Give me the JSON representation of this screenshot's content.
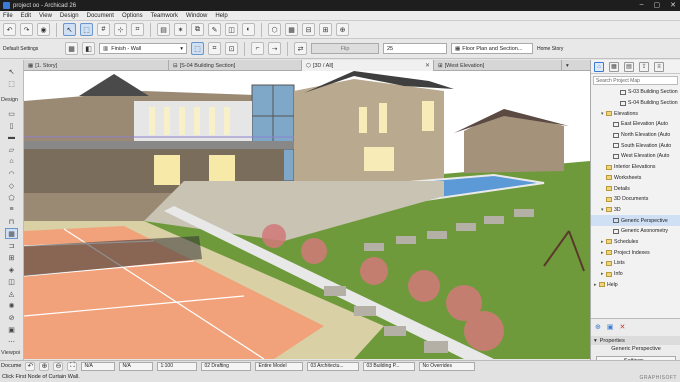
{
  "window": {
    "title": "project oo - Archicad 26"
  },
  "menu": [
    "File",
    "Edit",
    "View",
    "Design",
    "Document",
    "Options",
    "Teamwork",
    "Window",
    "Help"
  ],
  "toolbar2": {
    "default_settings": "Default Settings",
    "composite": "Finish - Wall",
    "flip": "Flip",
    "value": "25",
    "view_combo": "Floor Plan and Section...",
    "home_story": "Home Story"
  },
  "tabs": [
    {
      "label": "[1. Story]"
    },
    {
      "label": "[S-04 Building Section]"
    },
    {
      "label": "[3D / All]"
    },
    {
      "label": "[West Elevation]"
    }
  ],
  "toolbox": {
    "label_select": "Select",
    "label_design": "Design",
    "label_viewpoint": "Viewpoi",
    "label_document": "Docume"
  },
  "navigator": {
    "search_placeholder": "Search Project Map",
    "items": [
      {
        "label": "S-03 Building Section",
        "indent": 3,
        "type": "section"
      },
      {
        "label": "S-04 Building Section",
        "indent": 3,
        "type": "section"
      },
      {
        "label": "Elevations",
        "indent": 1,
        "type": "folder",
        "twist": "▾"
      },
      {
        "label": "East Elevation (Auto",
        "indent": 2,
        "type": "elev"
      },
      {
        "label": "North Elevation (Auto",
        "indent": 2,
        "type": "elev"
      },
      {
        "label": "South Elevation (Auto",
        "indent": 2,
        "type": "elev"
      },
      {
        "label": "West Elevation (Auto",
        "indent": 2,
        "type": "elev"
      },
      {
        "label": "Interior Elevations",
        "indent": 1,
        "type": "folder"
      },
      {
        "label": "Worksheets",
        "indent": 1,
        "type": "folder"
      },
      {
        "label": "Details",
        "indent": 1,
        "type": "folder"
      },
      {
        "label": "3D Documents",
        "indent": 1,
        "type": "folder"
      },
      {
        "label": "3D",
        "indent": 1,
        "type": "folder",
        "twist": "▾"
      },
      {
        "label": "Generic Perspective",
        "indent": 2,
        "type": "view",
        "selected": true
      },
      {
        "label": "Generic Axonometry",
        "indent": 2,
        "type": "view"
      },
      {
        "label": "Schedules",
        "indent": 1,
        "type": "folder",
        "twist": "▸"
      },
      {
        "label": "Project Indexes",
        "indent": 1,
        "type": "folder",
        "twist": "▸"
      },
      {
        "label": "Lists",
        "indent": 1,
        "type": "folder",
        "twist": "▸"
      },
      {
        "label": "Info",
        "indent": 1,
        "type": "folder",
        "twist": "▸"
      },
      {
        "label": "Help",
        "indent": 0,
        "type": "folder",
        "twist": "▸"
      }
    ],
    "properties_header": "Properties",
    "properties_value": "Generic Perspective",
    "settings_button": "Settings..."
  },
  "status": {
    "na1": "N/A",
    "na2": "N/A",
    "scale": "1:100",
    "layer_combo": "02 Drafting",
    "model": "Entire Model",
    "mvo": "03 Architectu...",
    "pen": "03 Building P...",
    "override": "No Overrides"
  },
  "hint": "Click First Node of Curtain Wall.",
  "brand": "GRAPHISOFT",
  "colors": {
    "tennis_court": "#f2a27a",
    "court_lines": "#ffffff",
    "grass": "#6e9a3c",
    "pool": "#5b9ad6",
    "roof": "#4a4a4a",
    "stone_wall": "#9b8a73",
    "glass": "#7fa8c8",
    "sky": "#ffffff",
    "accent": "#3a7bd5"
  }
}
